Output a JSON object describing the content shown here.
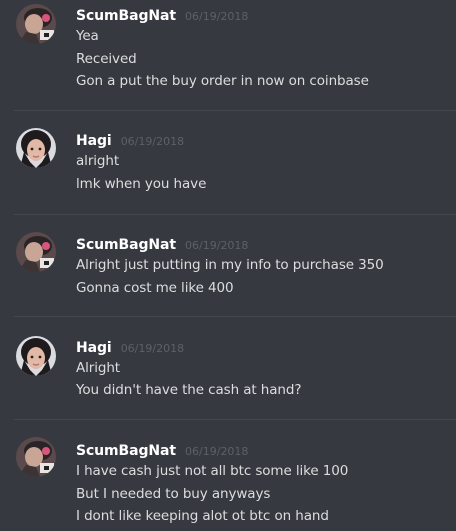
{
  "messages": [
    {
      "username": "ScumBagNat",
      "timestamp": "06/19/2018",
      "avatar": "scumbagnat-avatar",
      "lines": [
        "Yea",
        "Received",
        "Gon a put the buy order in now on coinbase"
      ]
    },
    {
      "username": "Hagi",
      "timestamp": "06/19/2018",
      "avatar": "hagi-avatar",
      "lines": [
        "alright",
        "lmk when you have"
      ]
    },
    {
      "username": "ScumBagNat",
      "timestamp": "06/19/2018",
      "avatar": "scumbagnat-avatar",
      "lines": [
        "Alright just putting in my info to purchase 350",
        "Gonna cost me like 400"
      ]
    },
    {
      "username": "Hagi",
      "timestamp": "06/19/2018",
      "avatar": "hagi-avatar",
      "lines": [
        "Alright",
        "You didn't have the cash at hand?"
      ]
    },
    {
      "username": "ScumBagNat",
      "timestamp": "06/19/2018",
      "avatar": "scumbagnat-avatar",
      "lines": [
        "I have cash just not all btc some like 100",
        "But I needed to buy anyways",
        "I dont like keeping alot ot btc on hand"
      ]
    }
  ],
  "colors": {
    "background": "#36393f",
    "username": "#ffffff",
    "timestamp": "#5d6066",
    "text": "#dcddde",
    "divider": "#44474d"
  }
}
